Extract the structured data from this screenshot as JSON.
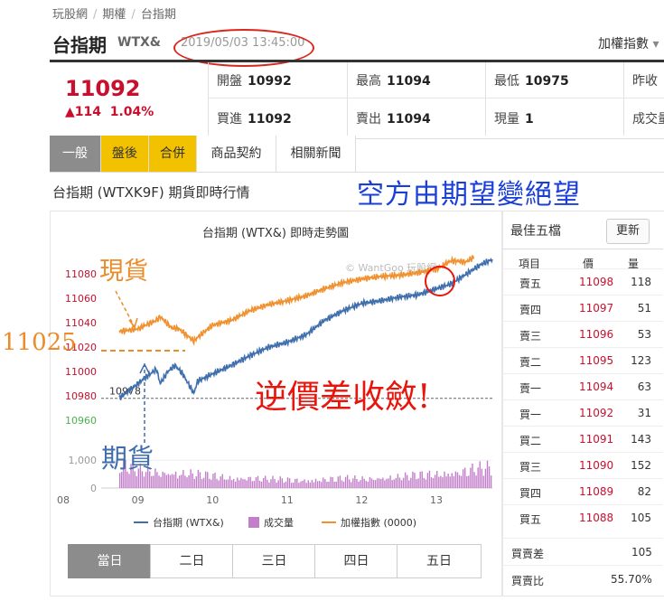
{
  "breadcrumb": [
    "玩股網",
    "期權",
    "台指期"
  ],
  "header": {
    "title": "台指期",
    "code": "WTX&",
    "timestamp": "2019/05/03 13:45:00",
    "index_link": "加權指數"
  },
  "quote": {
    "price": "11092",
    "change": "▲114",
    "change_pct": "1.04%",
    "stats": [
      {
        "label": "開盤",
        "value": "10992"
      },
      {
        "label": "最高",
        "value": "11094"
      },
      {
        "label": "最低",
        "value": "10975"
      },
      {
        "label": "昨收",
        "value": ""
      },
      {
        "label": "買進",
        "value": "11092"
      },
      {
        "label": "賣出",
        "value": "11094"
      },
      {
        "label": "現量",
        "value": "1"
      },
      {
        "label": "成交量",
        "value": ""
      }
    ]
  },
  "tabs": [
    "一般",
    "盤後",
    "合併",
    "商品契約",
    "相關新聞"
  ],
  "section_heading": "台指期 (WTXK9F) 期貨即時行情",
  "annotations": {
    "top": "空方由期望變絕望",
    "spot": "現貨",
    "spot_level": "11025",
    "futures": "期貨",
    "basis": "逆價差收斂!"
  },
  "chart_data": {
    "type": "line",
    "title": "台指期 (WTX&) 即時走勢圖",
    "watermark": "© WantGoo 玩股網",
    "x_ticks": [
      "08",
      "09",
      "10",
      "11",
      "12",
      "13"
    ],
    "y_ticks": [
      "11080",
      "11060",
      "11040",
      "11020",
      "11000",
      "10980",
      "10960"
    ],
    "volume_ticks": [
      "1,000",
      "0"
    ],
    "reference_label": "10978",
    "reference_value": 10978,
    "ylim": [
      10960,
      11095
    ],
    "volume_ylim": [
      0,
      1300
    ],
    "colors": {
      "futures": "#3f6ead",
      "index": "#f0902e",
      "volume": "#c27ec9",
      "up": "#c8102e",
      "down": "#4caf50"
    },
    "series": [
      {
        "name": "台指期 (WTX&)",
        "x": [
          8.75,
          8.85,
          9.0,
          9.1,
          9.25,
          9.3,
          9.4,
          9.5,
          9.6,
          9.75,
          9.8,
          9.9,
          10.0,
          10.25,
          10.5,
          10.75,
          11.0,
          11.25,
          11.5,
          11.75,
          12.0,
          12.25,
          12.5,
          12.75,
          13.0,
          13.2,
          13.4,
          13.6,
          13.75
        ],
        "values": [
          10978,
          10983,
          10990,
          10995,
          11002,
          10990,
          11000,
          11005,
          10998,
          10982,
          10992,
          10995,
          10998,
          11005,
          11013,
          11020,
          11024,
          11030,
          11042,
          11050,
          11056,
          11058,
          11061,
          11063,
          11068,
          11072,
          11080,
          11088,
          11092
        ]
      },
      {
        "name": "加權指數 (0000)",
        "x": [
          8.75,
          9.0,
          9.1,
          9.25,
          9.3,
          9.45,
          9.55,
          9.75,
          9.8,
          10.0,
          10.25,
          10.5,
          10.75,
          11.0,
          11.25,
          11.5,
          11.75,
          12.0,
          12.25,
          12.5,
          12.75,
          13.0,
          13.2,
          13.4,
          13.5
        ],
        "values": [
          11033,
          11035,
          11038,
          11042,
          11045,
          11036,
          11035,
          11025,
          11028,
          11038,
          11042,
          11050,
          11055,
          11058,
          11062,
          11068,
          11073,
          11076,
          11078,
          11079,
          11081,
          11084,
          11091,
          11090,
          11094
        ]
      }
    ],
    "volume": {
      "name": "成交量",
      "x": [
        8.75,
        9.0,
        9.25,
        9.5,
        9.75,
        10.0,
        10.25,
        10.5,
        10.75,
        11.0,
        11.25,
        11.5,
        11.75,
        12.0,
        12.25,
        12.5,
        12.75,
        13.0,
        13.25,
        13.5,
        13.75
      ],
      "values": [
        600,
        450,
        400,
        380,
        350,
        300,
        250,
        260,
        220,
        210,
        200,
        220,
        240,
        230,
        260,
        280,
        320,
        350,
        400,
        480,
        500
      ]
    },
    "legend": [
      "台指期 (WTX&)",
      "成交量",
      "加權指數 (0000)"
    ],
    "legend_position": "bottom"
  },
  "range_tabs": [
    "當日",
    "二日",
    "三日",
    "四日",
    "五日"
  ],
  "order_book": {
    "title": "最佳五檔",
    "refresh_label": "更新",
    "headers": [
      "項目",
      "價",
      "量"
    ],
    "rows": [
      {
        "label": "賣五",
        "price": "11098",
        "qty": "118"
      },
      {
        "label": "賣四",
        "price": "11097",
        "qty": "51"
      },
      {
        "label": "賣三",
        "price": "11096",
        "qty": "53"
      },
      {
        "label": "賣二",
        "price": "11095",
        "qty": "123"
      },
      {
        "label": "賣一",
        "price": "11094",
        "qty": "63"
      },
      {
        "label": "買一",
        "price": "11092",
        "qty": "31"
      },
      {
        "label": "買二",
        "price": "11091",
        "qty": "143"
      },
      {
        "label": "買三",
        "price": "11090",
        "qty": "152"
      },
      {
        "label": "買四",
        "price": "11089",
        "qty": "82"
      },
      {
        "label": "買五",
        "price": "11088",
        "qty": "105"
      }
    ],
    "diff_label": "買賣差",
    "diff_value": "105",
    "ratio_label": "買賣比",
    "ratio_value": "55.70%"
  }
}
